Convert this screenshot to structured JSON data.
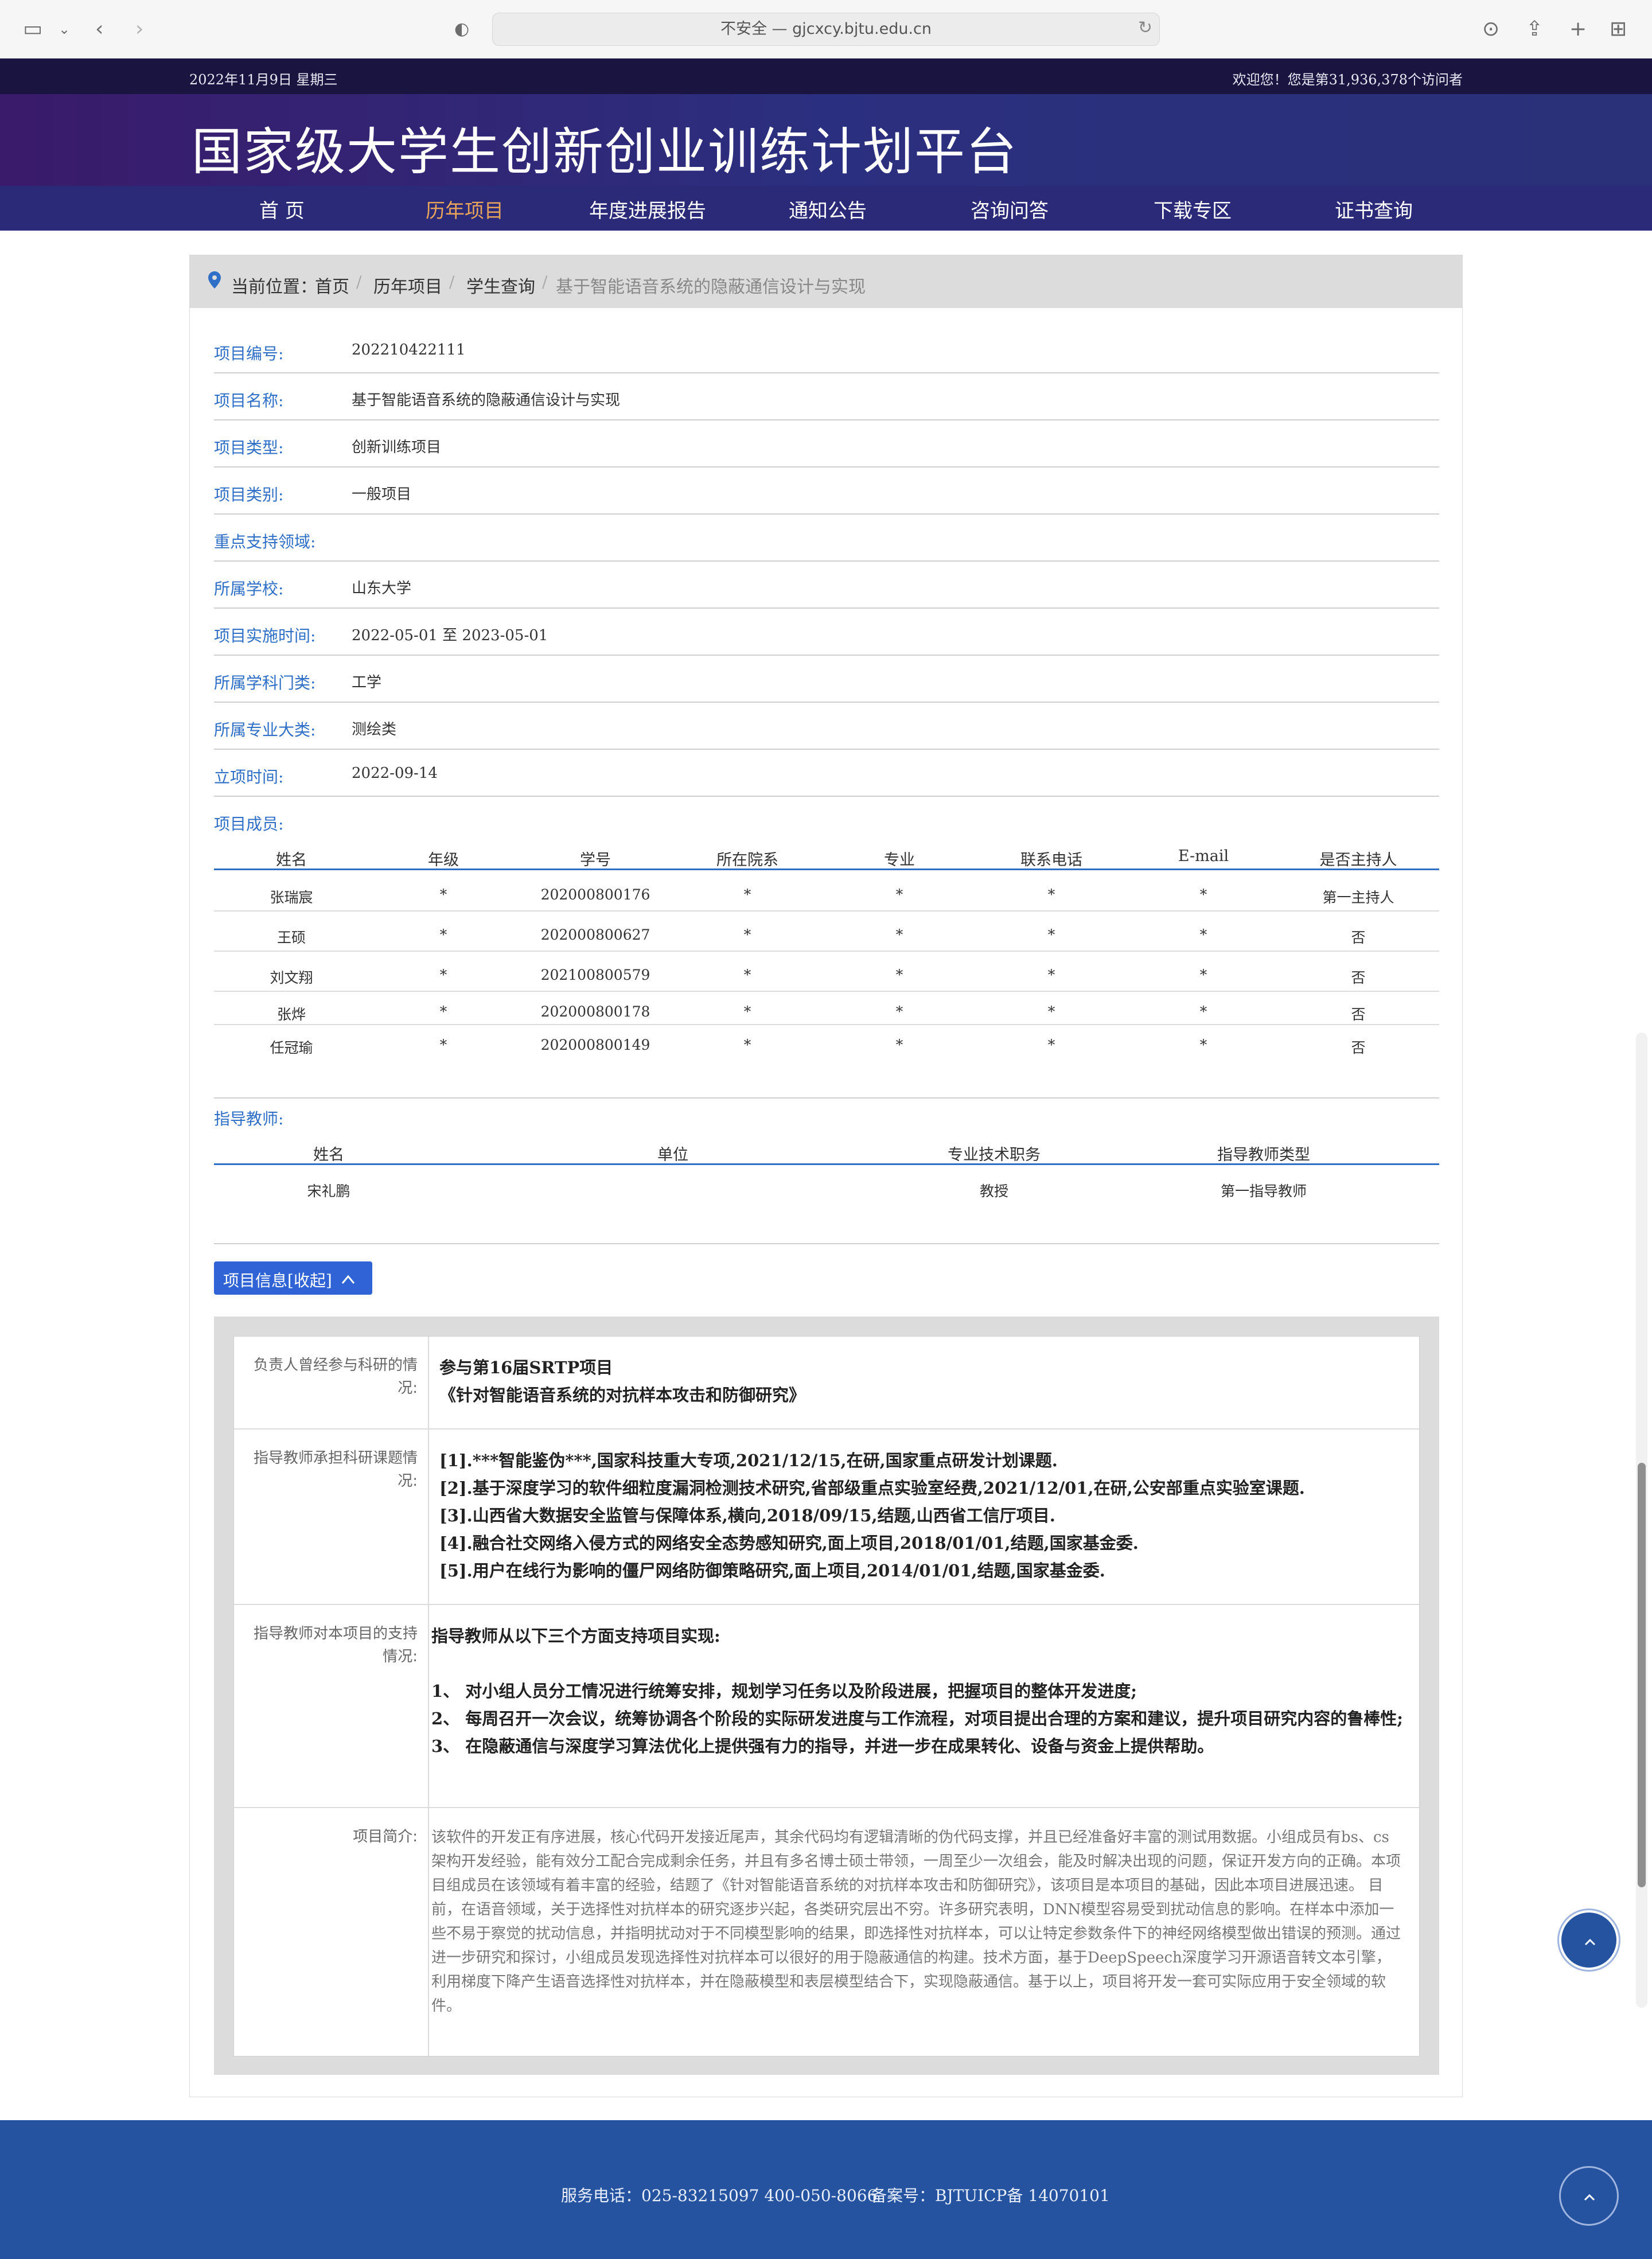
{
  "browser": {
    "url_text": "不安全 — gjcxcy.bjtu.edu.cn"
  },
  "site": {
    "date": "2022年11月9日 星期三",
    "visitor_text": "欢迎您！您是第31,936,378个访问者",
    "title": "国家级大学生创新创业训练计划平台",
    "nav": [
      "首 页",
      "历年项目",
      "年度进展报告",
      "通知公告",
      "咨询问答",
      "下载专区",
      "证书查询"
    ]
  },
  "breadcrumb": {
    "prefix": "当前位置：",
    "items": [
      "首页",
      "历年项目",
      "学生查询",
      "基于智能语音系统的隐蔽通信设计与实现"
    ]
  },
  "fields": [
    {
      "label": "项目编号:",
      "value": "202210422111"
    },
    {
      "label": "项目名称:",
      "value": "基于智能语音系统的隐蔽通信设计与实现"
    },
    {
      "label": "项目类型:",
      "value": "创新训练项目"
    },
    {
      "label": "项目类别:",
      "value": "一般项目"
    },
    {
      "label": "重点支持领域:",
      "value": ""
    },
    {
      "label": "所属学校:",
      "value": "山东大学"
    },
    {
      "label": "项目实施时间:",
      "value": "2022-05-01 至 2023-05-01"
    },
    {
      "label": "所属学科门类:",
      "value": "工学"
    },
    {
      "label": "所属专业大类:",
      "value": "测绘类"
    },
    {
      "label": "立项时间:",
      "value": "2022-09-14"
    }
  ],
  "members": {
    "label": "项目成员:",
    "headers": [
      "姓名",
      "年级",
      "学号",
      "所在院系",
      "专业",
      "联系电话",
      "E-mail",
      "是否主持人"
    ],
    "rows": [
      [
        "张瑞宸",
        "*",
        "202000800176",
        "*",
        "*",
        "*",
        "*",
        "第一主持人"
      ],
      [
        "王硕",
        "*",
        "202000800627",
        "*",
        "*",
        "*",
        "*",
        "否"
      ],
      [
        "刘文翔",
        "*",
        "202100800579",
        "*",
        "*",
        "*",
        "*",
        "否"
      ],
      [
        "张烨",
        "*",
        "202000800178",
        "*",
        "*",
        "*",
        "*",
        "否"
      ],
      [
        "任冠瑜",
        "*",
        "202000800149",
        "*",
        "*",
        "*",
        "*",
        "否"
      ]
    ]
  },
  "teachers": {
    "label": "指导教师:",
    "headers": [
      "姓名",
      "单位",
      "专业技术职务",
      "指导教师类型"
    ],
    "rows": [
      [
        "宋礼鹏",
        "",
        "教授",
        "第一指导教师"
      ]
    ]
  },
  "collapse_button": "项目信息[收起]",
  "info": {
    "rows": [
      {
        "key": "负责人曾经参与科研的情况:",
        "lines": [
          "参与第16届SRTP项目",
          "《针对智能语音系统的对抗样本攻击和防御研究》"
        ]
      },
      {
        "key": "指导教师承担科研课题情况:",
        "lines": [
          "[1].***智能鉴伪***,国家科技重大专项,2021/12/15,在研,国家重点研发计划课题.",
          "[2].基于深度学习的软件细粒度漏洞检测技术研究,省部级重点实验室经费,2021/12/01,在研,公安部重点实验室课题.",
          "[3].山西省大数据安全监管与保障体系,横向,2018/09/15,结题,山西省工信厅项目.",
          "[4].融合社交网络入侵方式的网络安全态势感知研究,面上项目,2018/01/01,结题,国家基金委.",
          "[5].用户在线行为影响的僵尸网络防御策略研究,面上项目,2014/01/01,结题,国家基金委."
        ]
      },
      {
        "key": "指导教师对本项目的支持情况:",
        "lines": [
          "指导教师从以下三个方面支持项目实现:",
          "",
          "1、 对小组人员分工情况进行统筹安排，规划学习任务以及阶段进展，把握项目的整体开发进度;",
          "2、 每周召开一次会议，统筹协调各个阶段的实际研发进度与工作流程，对项目提出合理的方案和建议，提升项目研究内容的鲁棒性;",
          "3、 在隐蔽通信与深度学习算法优化上提供强有力的指导，并进一步在成果转化、设备与资金上提供帮助。"
        ]
      },
      {
        "key": "项目简介:",
        "text": "该软件的开发正有序进展，核心代码开发接近尾声，其余代码均有逻辑清晰的伪代码支撑，并且已经准备好丰富的测试用数据。小组成员有bs、cs架构开发经验，能有效分工配合完成剩余任务，并且有多名博士硕士带领，一周至少一次组会，能及时解决出现的问题，保证开发方向的正确。本项目组成员在该领域有着丰富的经验，结题了《针对智能语音系统的对抗样本攻击和防御研究》，该项目是本项目的基础，因此本项目进展迅速。 目前，在语音领域，关于选择性对抗样本的研究逐步兴起，各类研究层出不穷。许多研究表明，DNN模型容易受到扰动信息的影响。在样本中添加一些不易于察觉的扰动信息，并指明扰动对于不同模型影响的结果，即选择性对抗样本，可以让特定参数条件下的神经网络模型做出错误的预测。通过进一步研究和探讨，小组成员发现选择性对抗样本可以很好的用于隐蔽通信的构建。技术方面，基于DeepSpeech深度学习开源语音转文本引擎，利用梯度下降产生语音选择性对抗样本，并在隐蔽模型和表层模型结合下，实现隐蔽通信。基于以上，项目将开发一套可实际应用于安全领域的软件。"
      }
    ]
  },
  "footer": {
    "phone": "服务电话：025-83215097 400-050-8066",
    "icp": "备案号：BJTUICP备 14070101"
  },
  "colors": {
    "accent_blue": "#2f6fc7",
    "nav_active": "#e8a45a",
    "footer_bg": "#2553a0"
  }
}
